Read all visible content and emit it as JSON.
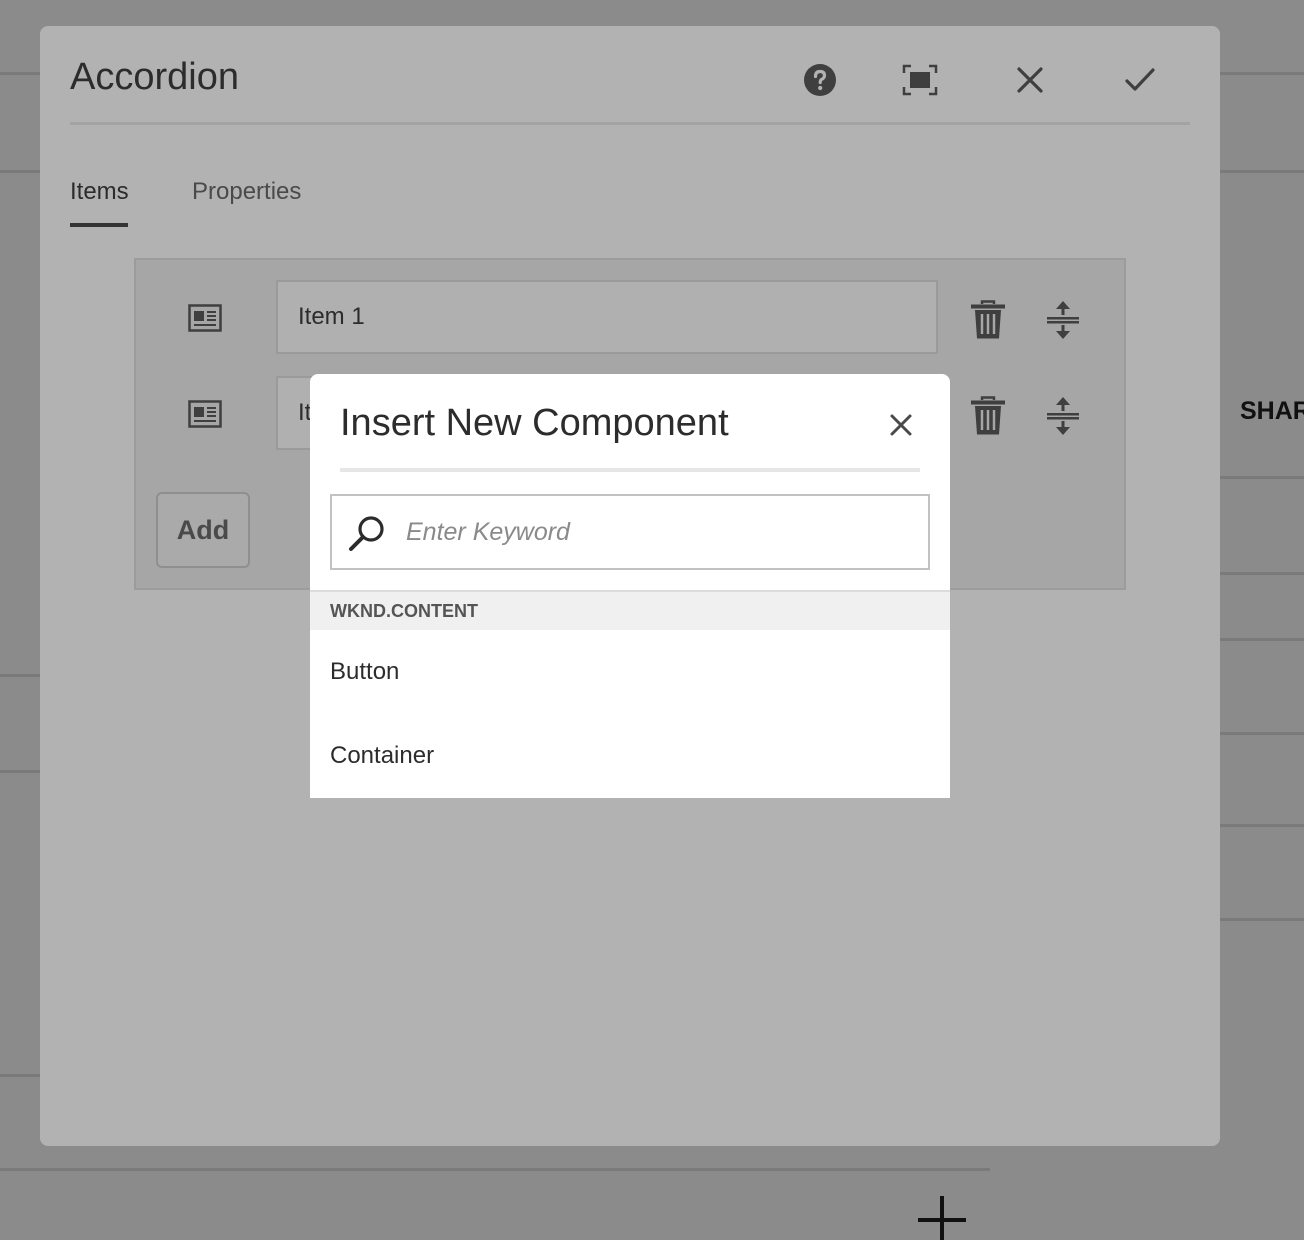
{
  "background": {
    "share_label": "SHAR"
  },
  "dialog": {
    "title": "Accordion",
    "header_actions": [
      "help-icon",
      "fullscreen-icon",
      "close-icon",
      "checkmark-icon"
    ],
    "tabs": [
      {
        "label": "Items",
        "active": true
      },
      {
        "label": "Properties",
        "active": false
      }
    ],
    "items": [
      {
        "value": "Item 1"
      },
      {
        "value": "It"
      }
    ],
    "add_label": "Add"
  },
  "popover": {
    "title": "Insert New Component",
    "search_placeholder": "Enter Keyword",
    "group": "WKND.CONTENT",
    "components": [
      "Button",
      "Container"
    ]
  }
}
